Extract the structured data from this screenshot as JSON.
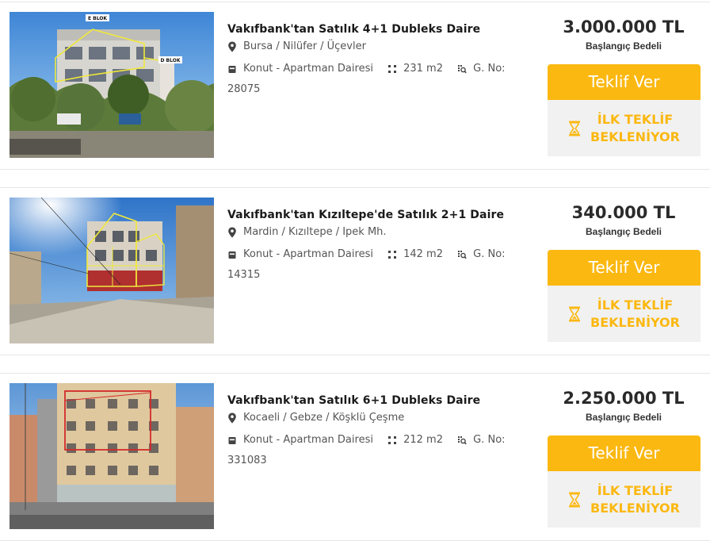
{
  "listings": [
    {
      "title": "Vakıfbank'tan Satılık 4+1 Dubleks Daire",
      "location": "Bursa / Nilüfer / Üçevler",
      "type": "Konut - Apartman Dairesi",
      "area": "231 m2",
      "gno_label": "G. No:",
      "gno": "28075",
      "price": "3.000.000 TL",
      "price_label": "Başlangıç Bedeli",
      "offer_label": "Teklif Ver",
      "status_line1": "İLK TEKLİF",
      "status_line2": "BEKLENİYOR",
      "photo_labels": [
        "E BLOK",
        "D BLOK"
      ]
    },
    {
      "title": "Vakıfbank'tan Kızıltepe'de Satılık 2+1 Daire",
      "location": "Mardin / Kızıltepe / Ipek Mh.",
      "type": "Konut - Apartman Dairesi",
      "area": "142 m2",
      "gno_label": "G. No:",
      "gno": "14315",
      "price": "340.000 TL",
      "price_label": "Başlangıç Bedeli",
      "offer_label": "Teklif Ver",
      "status_line1": "İLK TEKLİF",
      "status_line2": "BEKLENİYOR",
      "photo_labels": []
    },
    {
      "title": "Vakıfbank'tan Satılık 6+1 Dubleks Daire",
      "location": "Kocaeli / Gebze / Köşklü Çeşme",
      "type": "Konut - Apartman Dairesi",
      "area": "212 m2",
      "gno_label": "G. No:",
      "gno": "331083",
      "price": "2.250.000 TL",
      "price_label": "Başlangıç Bedeli",
      "offer_label": "Teklif Ver",
      "status_line1": "İLK TEKLİF",
      "status_line2": "BEKLENİYOR",
      "photo_labels": []
    }
  ],
  "icons": {
    "location": "map-pin-icon",
    "type": "building-icon",
    "area": "area-icon",
    "gno": "listing-number-icon",
    "status": "hourglass-icon"
  },
  "colors": {
    "accent": "#fbb811",
    "status_bg": "#f1f1f1",
    "title": "#1a1a1a",
    "meta": "#555555"
  }
}
